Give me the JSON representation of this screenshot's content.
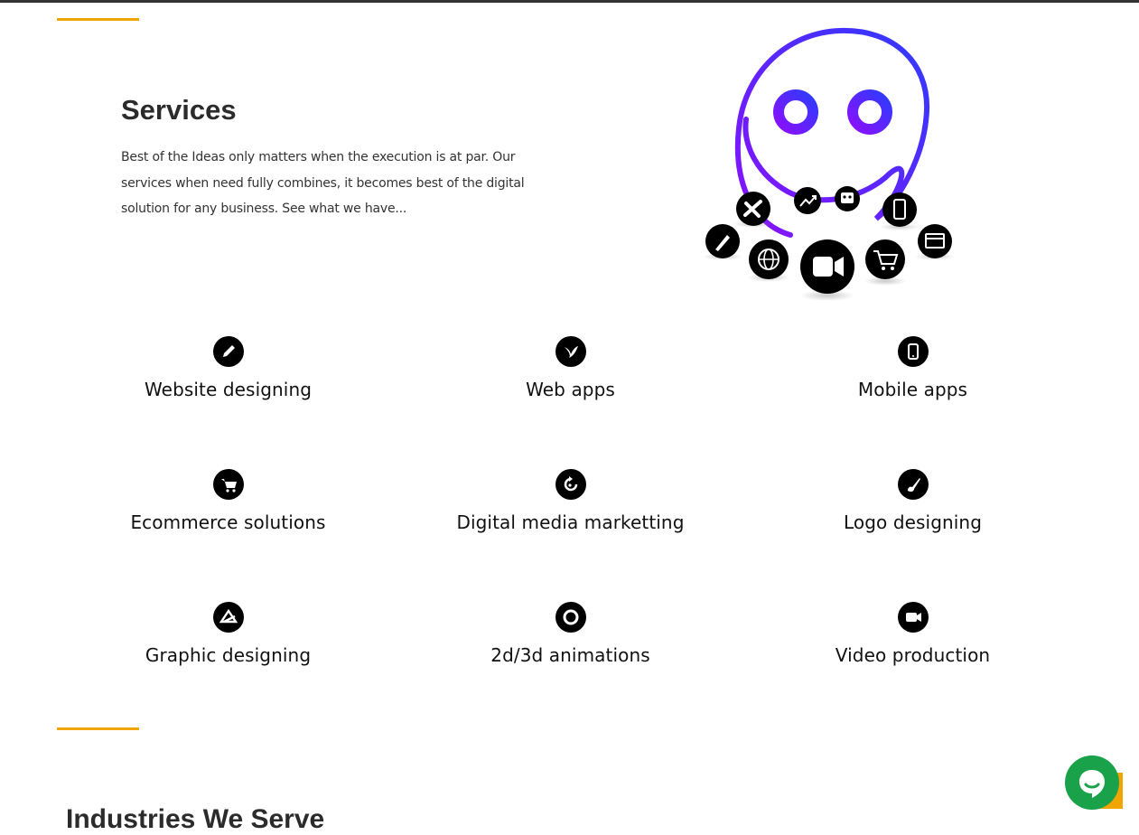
{
  "colors": {
    "accent": "#f0a500",
    "chat_green": "#1aa24a",
    "chat_back": "#f0a500",
    "icon_bg": "#000000",
    "hero_gradient_start": "#8a10ff",
    "hero_gradient_end": "#2f3bff"
  },
  "services": {
    "title": "Services",
    "description": "Best of the Ideas only matters when the execution is at par. Our services when need fully combines, it becomes best of the digital solution for any business. See what we have..."
  },
  "hero_icons": [
    "brush-icon",
    "tools-icon",
    "trending-icon",
    "robot-icon",
    "mobile-icon",
    "web-icon",
    "globe-icon",
    "video-icon",
    "cart-icon"
  ],
  "service_items": [
    {
      "label": "Website designing",
      "icon": "pencil-icon"
    },
    {
      "label": "Web apps",
      "icon": "bird-icon"
    },
    {
      "label": "Mobile apps",
      "icon": "mobile-icon"
    },
    {
      "label": "Ecommerce solutions",
      "icon": "cart-icon"
    },
    {
      "label": "Digital media marketting",
      "icon": "refresh-icon"
    },
    {
      "label": "Logo designing",
      "icon": "brush-icon"
    },
    {
      "label": "Graphic designing",
      "icon": "graphic-icon"
    },
    {
      "label": "2d/3d animations",
      "icon": "ring-icon"
    },
    {
      "label": "Video production",
      "icon": "video-icon"
    }
  ],
  "industries": {
    "title": "Industries We Serve"
  },
  "chat": {
    "icon": "chat-bubble-icon"
  }
}
